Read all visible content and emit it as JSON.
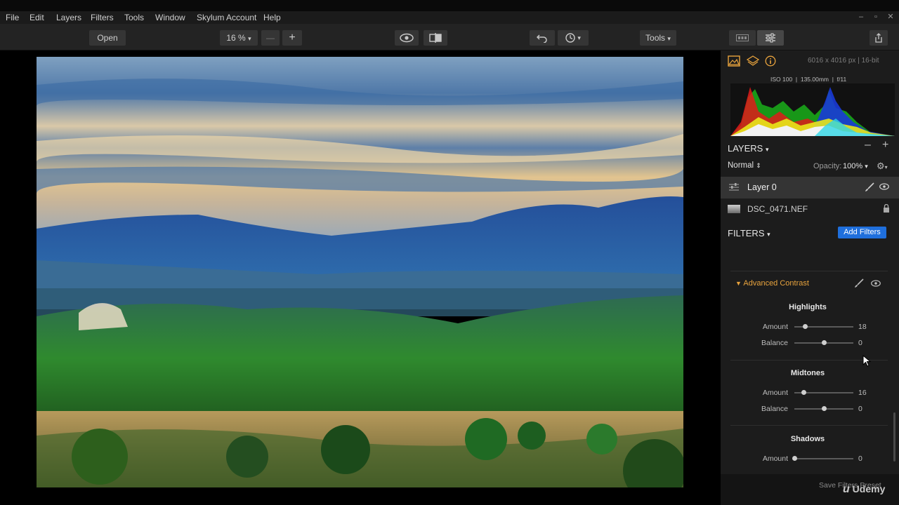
{
  "menu": {
    "items": [
      "File",
      "Edit",
      "Layers",
      "Filters",
      "Tools",
      "Window",
      "Skylum Account",
      "Help"
    ]
  },
  "window_controls": {
    "minimize": "–",
    "maximize": "▫",
    "close": "✕"
  },
  "toolbar": {
    "open_label": "Open",
    "zoom_value": "16 %",
    "zoom_minus": "—",
    "zoom_plus": "+",
    "tools_label": "Tools"
  },
  "info": {
    "image_size": "6016 x 4016 px",
    "bit_depth": "16-bit",
    "exif": "ISO 100  |  135.00mm  |  f/11"
  },
  "layers": {
    "title": "LAYERS",
    "blend_mode": "Normal",
    "opacity_label": "Opacity:",
    "opacity_value": "100%",
    "items": [
      {
        "name": "Layer 0",
        "selected": true
      },
      {
        "name": "DSC_0471.NEF",
        "selected": false
      }
    ]
  },
  "filters": {
    "title": "FILTERS",
    "add_label": "Add Filters",
    "active_filter": "Advanced Contrast",
    "accent_color": "#e8a33d",
    "groups": [
      {
        "name": "Highlights",
        "sliders": [
          {
            "label": "Amount",
            "value": "18",
            "fraction": 0.18
          },
          {
            "label": "Balance",
            "value": "0",
            "fraction": 0.5
          }
        ]
      },
      {
        "name": "Midtones",
        "sliders": [
          {
            "label": "Amount",
            "value": "16",
            "fraction": 0.16
          },
          {
            "label": "Balance",
            "value": "0",
            "fraction": 0.5
          }
        ]
      },
      {
        "name": "Shadows",
        "sliders": [
          {
            "label": "Amount",
            "value": "0",
            "fraction": 0.0
          }
        ]
      }
    ],
    "save_preset_label": "Save Filters Preset"
  },
  "watermark": "Udemy"
}
